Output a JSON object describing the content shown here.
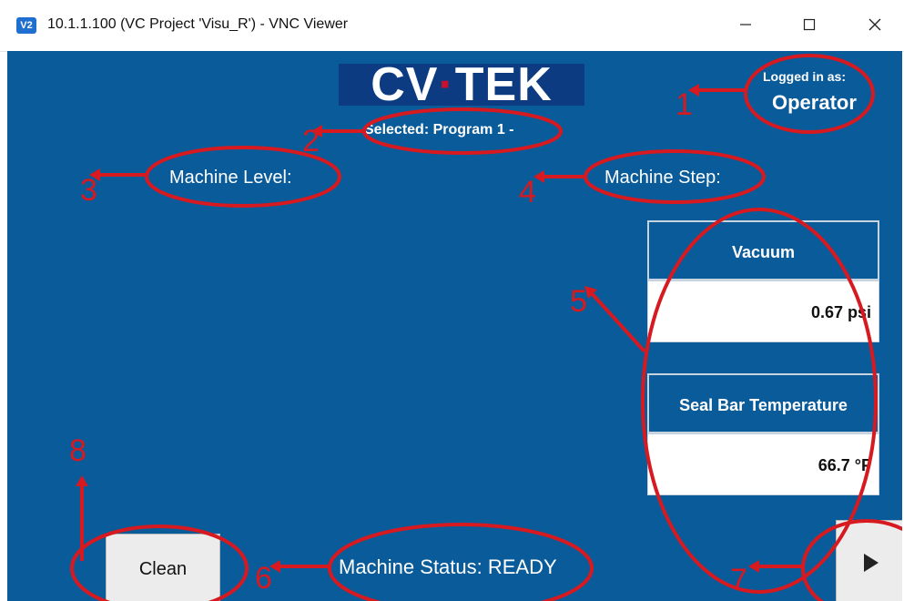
{
  "window": {
    "app_icon": "V2",
    "title": "10.1.1.100 (VC Project 'Visu_R') - VNC Viewer",
    "minimize_icon": "minimize-icon",
    "maximize_icon": "maximize-icon",
    "close_icon": "close-icon"
  },
  "logo": {
    "text_left": "CV",
    "dot": "·",
    "text_right": "TEK"
  },
  "login": {
    "label": "Logged in as:",
    "user": "Operator"
  },
  "program": {
    "selected": "Selected: Program 1 -"
  },
  "machine": {
    "level_label": "Machine Level:",
    "step_label": "Machine Step:",
    "status": "Machine Status: READY"
  },
  "vacuum": {
    "label": "Vacuum",
    "value": "0.67 psi"
  },
  "seal_bar": {
    "label": "Seal Bar Temperature",
    "value": "66.7 °F"
  },
  "buttons": {
    "clean": "Clean",
    "next_icon": "play-arrow-icon"
  },
  "annotations": [
    "1",
    "2",
    "3",
    "4",
    "5",
    "6",
    "7",
    "8"
  ],
  "colors": {
    "hmi_background": "#0a5b9a",
    "annotation": "#d71920",
    "logo_dot": "#c8102e"
  }
}
